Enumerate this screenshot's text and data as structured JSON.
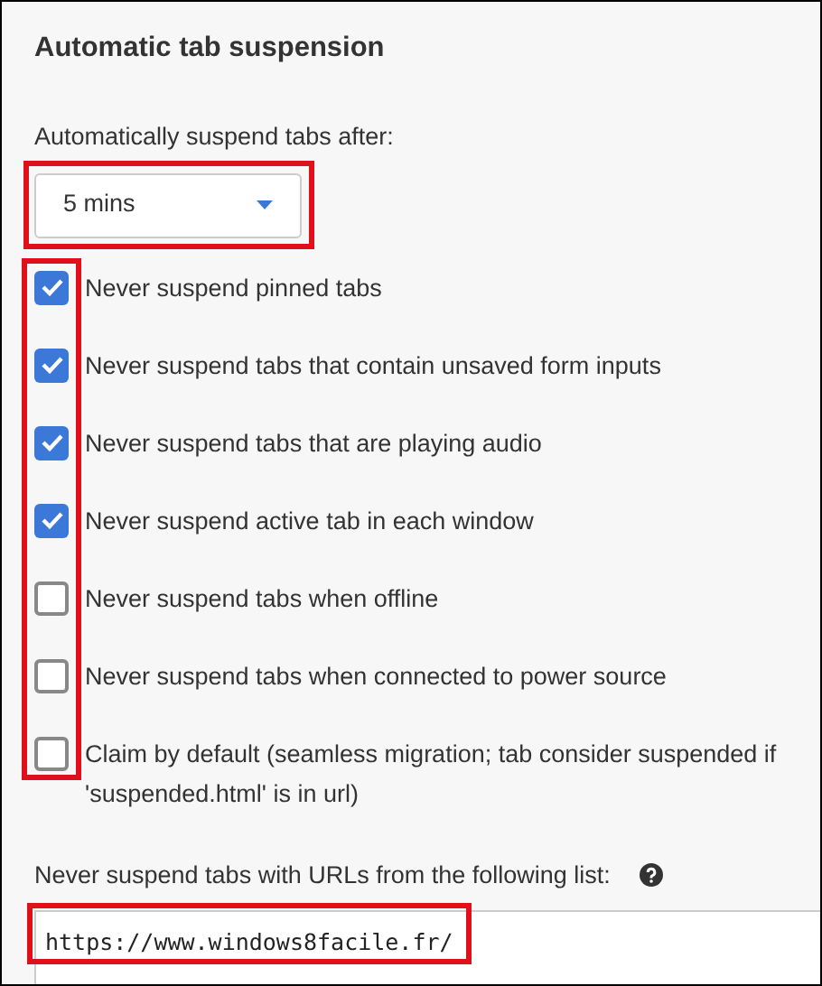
{
  "section": {
    "title": "Automatic tab suspension"
  },
  "suspend_after": {
    "label": "Automatically suspend tabs after:",
    "value": "5 mins",
    "highlighted": true
  },
  "options_highlighted": true,
  "options": [
    {
      "label": "Never suspend pinned tabs",
      "checked": true
    },
    {
      "label": "Never suspend tabs that contain unsaved form inputs",
      "checked": true
    },
    {
      "label": "Never suspend tabs that are playing audio",
      "checked": true
    },
    {
      "label": "Never suspend active tab in each window",
      "checked": true
    },
    {
      "label": "Never suspend tabs when offline",
      "checked": false
    },
    {
      "label": "Never suspend tabs when connected to power source",
      "checked": false
    },
    {
      "label": "Claim by default (seamless migration; tab consider suspended if 'suspended.html' is in url)",
      "checked": false
    }
  ],
  "whitelist": {
    "label": "Never suspend tabs with URLs from the following list:",
    "value": "https://www.windows8facile.fr/",
    "highlighted": true
  }
}
